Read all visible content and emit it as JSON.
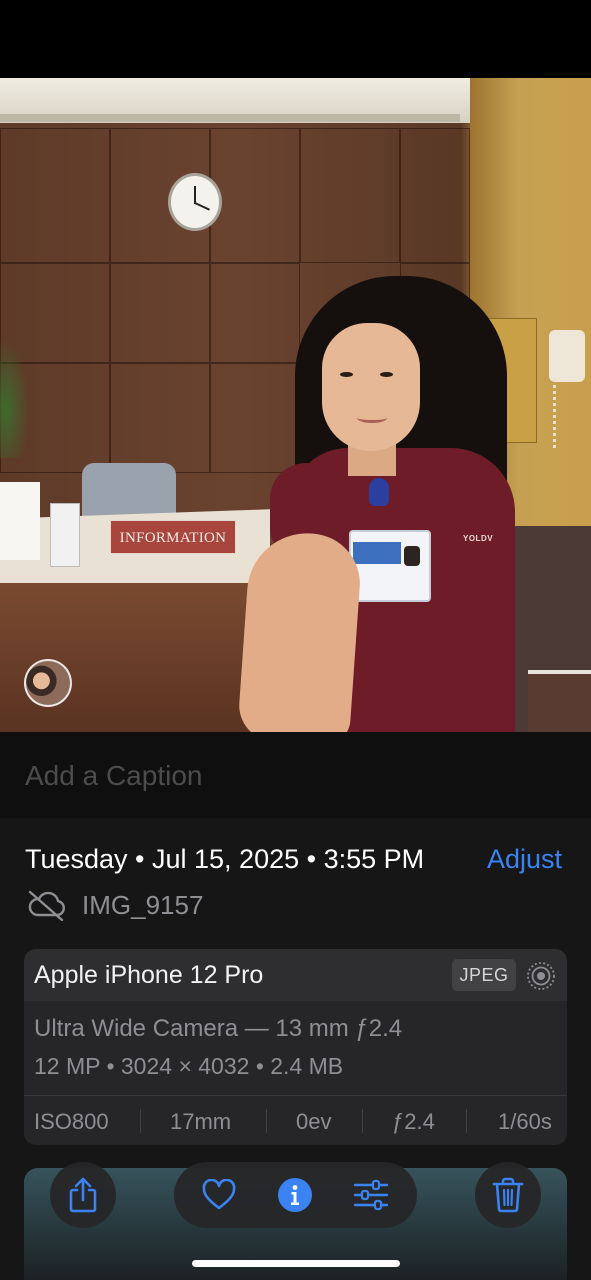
{
  "photo": {
    "sign_text": "INFORMATION",
    "shirt_text": "YOLDV"
  },
  "caption": {
    "placeholder": "Add a Caption"
  },
  "info": {
    "date_time": "Tuesday • Jul 15, 2025 • 3:55 PM",
    "adjust_label": "Adjust",
    "filename": "IMG_9157",
    "cloud_icon": "cloud-slash-icon"
  },
  "camera_card": {
    "device": "Apple iPhone 12 Pro",
    "format": "JPEG",
    "lens": "Ultra Wide Camera — 13 mm ƒ2.4",
    "specs": "12 MP • 3024 × 4032 • 2.4 MB",
    "exif": [
      "ISO800",
      "17mm",
      "0ev",
      "ƒ2.4",
      "1/60s"
    ]
  },
  "toolbar": {
    "share_icon": "share-icon",
    "favorite_icon": "heart-icon",
    "info_icon": "info-icon",
    "edit_icon": "sliders-icon",
    "delete_icon": "trash-icon"
  },
  "colors": {
    "accent": "#3b83f2",
    "background": "#161616",
    "card": "#262628",
    "secondary_text": "#8e8e93"
  }
}
